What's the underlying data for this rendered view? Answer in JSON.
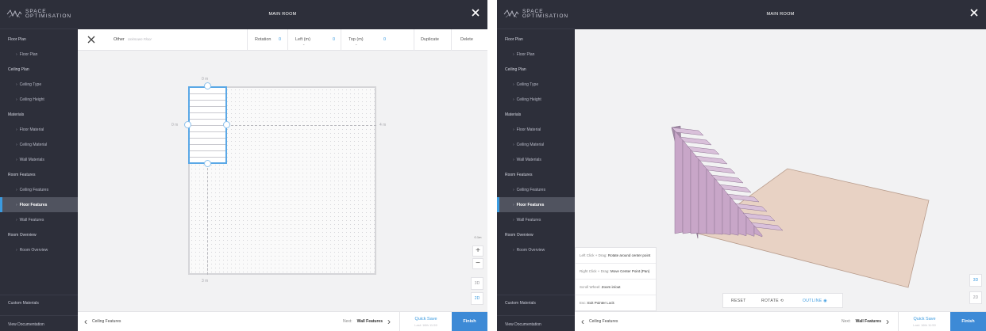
{
  "brand": {
    "line1": "SPACE",
    "line2": "OPTIMISATION"
  },
  "sidebar": [
    {
      "label": "Floor Plan",
      "kind": "head"
    },
    {
      "label": "Floor Plan",
      "kind": "sub"
    },
    {
      "label": "Ceiling Plan",
      "kind": "head"
    },
    {
      "label": "Ceiling Type",
      "kind": "sub"
    },
    {
      "label": "Ceiling Height",
      "kind": "sub"
    },
    {
      "label": "Materials",
      "kind": "head"
    },
    {
      "label": "Floor Material",
      "kind": "sub"
    },
    {
      "label": "Ceiling Material",
      "kind": "sub"
    },
    {
      "label": "Wall Materials",
      "kind": "sub"
    },
    {
      "label": "Room Features",
      "kind": "head"
    },
    {
      "label": "Ceiling Features",
      "kind": "sub"
    },
    {
      "label": "Floor Features",
      "kind": "sub",
      "active": true
    },
    {
      "label": "Wall Features",
      "kind": "sub"
    },
    {
      "label": "Room Overview",
      "kind": "head"
    },
    {
      "label": "Room Overview",
      "kind": "sub"
    }
  ],
  "sidebar_bottom": {
    "custom": "Custom Materials",
    "docs": "View Documentation"
  },
  "header": {
    "title": "MAIN ROOM",
    "close_icon": "close-icon"
  },
  "toolbar": {
    "item": "Other",
    "item_hint": "Unknown Floor",
    "rotation_label": "Rotation",
    "rotation_value": "0",
    "left_label": "Left (m)",
    "left_value": "0",
    "top_label": "Top (m)",
    "top_value": "0",
    "duplicate": "Duplicate",
    "delete": "Delete"
  },
  "plan": {
    "top_dim": "0 m",
    "left_dim": "0 m",
    "right_dim": "4 m",
    "bottom_dim": "3 m",
    "stair_steps": 11
  },
  "zoom": {
    "scale": "0.1m",
    "plus": "+",
    "minus": "−",
    "view_3d": "3D",
    "view_2d": "2D"
  },
  "footer": {
    "prev": "Ceiling Features",
    "next_prefix": "Next:",
    "next": "Wall Features",
    "quick_save": "Quick Save",
    "last_saved": "Last: 16th 11:59",
    "finish": "Finish"
  },
  "view3d": {
    "hints": [
      {
        "key": "Left Click + Drag:",
        "text": "Rotate around center point"
      },
      {
        "key": "Right Click + Drag:",
        "text": "Move Center Point (Pan)"
      },
      {
        "key": "Scroll Wheel:",
        "text": "Zoom in/out"
      },
      {
        "key": "Esc:",
        "text": "Exit Pointer Lock"
      }
    ],
    "controls": {
      "reset": "RESET",
      "rotate": "ROTATE ⟲",
      "outline": "OUTLINE ◉"
    }
  },
  "colors": {
    "accent": "#3b9be0",
    "sidebar": "#2d2f3a",
    "stair": "#c8a6c8",
    "floor": "#e8d2c4"
  }
}
